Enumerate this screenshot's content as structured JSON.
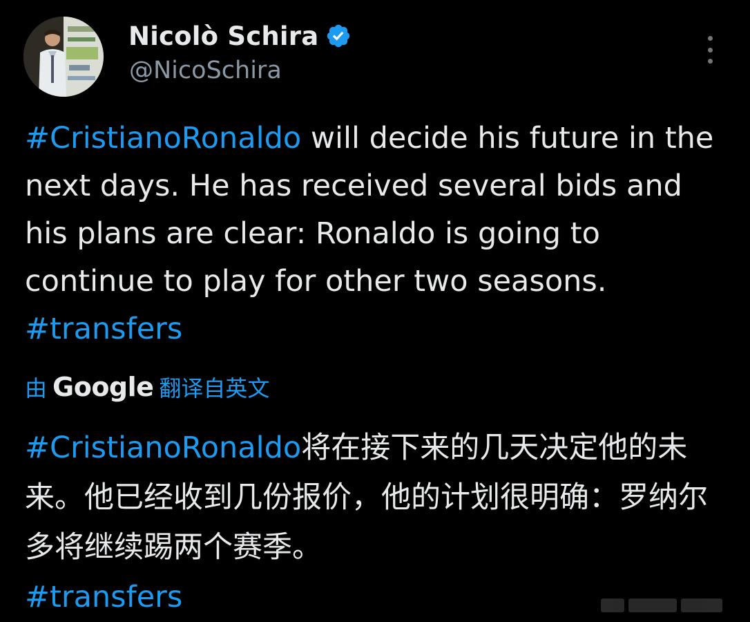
{
  "author": {
    "name": "Nicolò Schira",
    "handle": "@NicoSchira",
    "verified": true
  },
  "tweet": {
    "hashtag_1": "#CristianoRonaldo",
    "text_1": " will decide his future in the next days. He has received several bids and his plans are clear: Ronaldo is going to continue to play for other two seasons. ",
    "hashtag_2": "#transfers"
  },
  "translation": {
    "prefix": "由",
    "provider": "Google",
    "suffix": "翻译自英文",
    "hashtag_1": "#CristianoRonaldo",
    "text_1": "将在接下来的几天决定他的未来。他已经收到几份报价，他的计划很明确：罗纳尔多将继续踢两个赛季。",
    "hashtag_2": "#transfers"
  },
  "colors": {
    "background": "#000000",
    "accent": "#1d9bf0",
    "text": "#e7e9ea",
    "muted": "#8b98a5"
  },
  "icons": [
    "verified-badge-icon",
    "more-options-icon"
  ]
}
